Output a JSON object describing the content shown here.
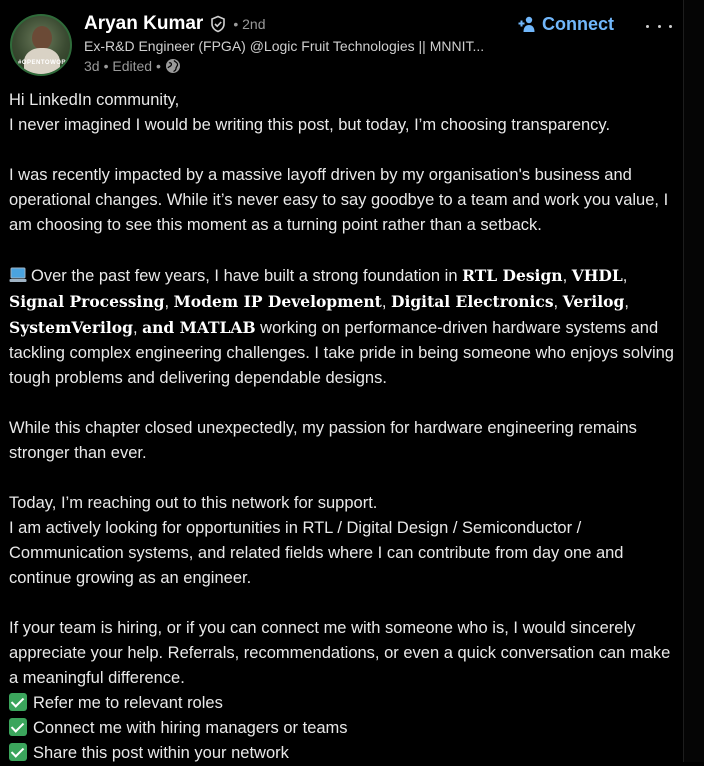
{
  "author": {
    "name": "Aryan Kumar",
    "degree": "• 2nd",
    "headline": "Ex-R&D Engineer (FPGA) @Logic Fruit Technologies || MNNIT...",
    "time": "3d",
    "edited": "• Edited •",
    "avatar_text": "#OPENTOWORK"
  },
  "actions": {
    "connect_label": "Connect"
  },
  "post": {
    "l1": "Hi LinkedIn community,",
    "l2": "I never imagined I would be writing this post, but today, I’m choosing transparency.",
    "p2": "I was recently impacted by a massive layoff driven by my organisation's business and operational changes. While it’s never easy to say goodbye to a team and work you value, I am choosing to see this moment as a turning point rather than a setback.",
    "p3_a": "Over the past few years, I have built a strong foundation in ",
    "s1": "RTL Design",
    "c1": ", ",
    "s2": "VHDL",
    "c2": ", ",
    "s3": "Signal Processing",
    "c3": ", ",
    "s4": "Modem IP Development",
    "c4": ", ",
    "s5": "Digital Electronics",
    "c5": ", ",
    "s6": "Verilog",
    "c6": ", ",
    "s7": "SystemVerilog",
    "c7": ", ",
    "s8": "and MATLAB",
    "p3_b": " working on performance-driven hardware systems and tackling complex engineering challenges. I take pride in being someone who enjoys solving tough problems and delivering dependable designs.",
    "p4": "While this chapter closed unexpectedly, my passion for hardware engineering remains stronger than ever.",
    "p5_1": "Today, I’m reaching out to this network for support.",
    "p5_2": "I am actively looking for opportunities in RTL / Digital Design / Semiconductor / Communication systems, and related fields where I can contribute from day one and continue growing as an engineer.",
    "p6": "If your team is hiring, or if you can connect me with someone who is, I would sincerely appreciate your help. Referrals, recommendations, or even a quick conversation can make a meaningful difference.",
    "list": [
      "Refer me to relevant roles",
      "Connect me with hiring managers or teams",
      "Share this post within your network"
    ]
  },
  "colors": {
    "link": "#71b7fb",
    "check": "#3ba55c",
    "bg": "#000000"
  },
  "icons": [
    "verified-shield-icon",
    "globe-icon",
    "add-person-icon",
    "more-dots-icon",
    "laptop-emoji-icon",
    "check-mark-emoji-icon"
  ]
}
